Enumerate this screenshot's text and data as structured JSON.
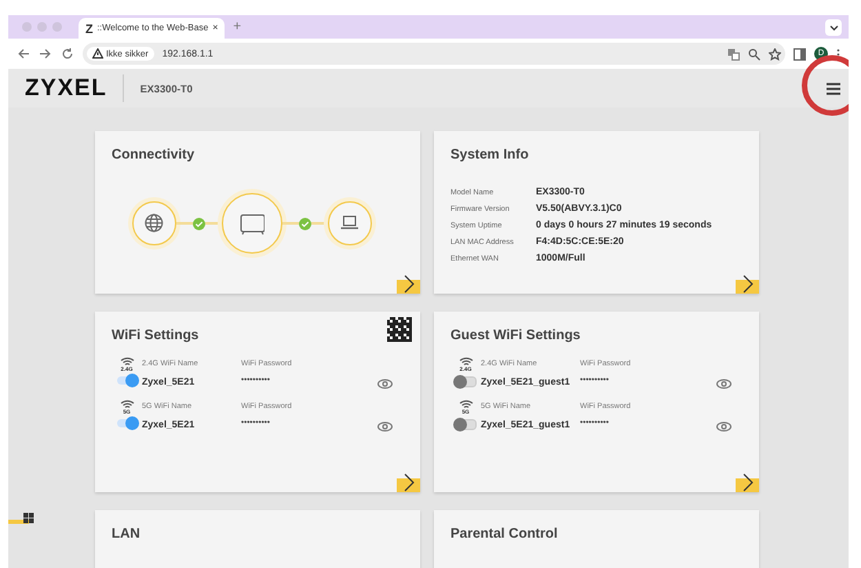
{
  "browser": {
    "tab_icon": "Z",
    "tab_title": "::Welcome to the Web-Base",
    "tab_close": "×",
    "new_tab": "+",
    "security": "Ikke sikker",
    "url": "192.168.1.1",
    "profile": "D"
  },
  "header": {
    "logo": "ZYXEL",
    "model": "EX3300-T0"
  },
  "connectivity": {
    "title": "Connectivity",
    "links": [
      {
        "connected": true
      },
      {
        "connected": true
      }
    ]
  },
  "system_info": {
    "title": "System Info",
    "rows": [
      {
        "label": "Model Name",
        "value": "EX3300-T0"
      },
      {
        "label": "Firmware Version",
        "value": "V5.50(ABVY.3.1)C0"
      },
      {
        "label": "System Uptime",
        "value": "0 days 0 hours 27 minutes 19 seconds"
      },
      {
        "label": "LAN MAC Address",
        "value": "F4:4D:5C:CE:5E:20"
      },
      {
        "label": "Ethernet WAN",
        "value": "1000M/Full"
      }
    ]
  },
  "wifi": {
    "title": "WiFi Settings",
    "networks": [
      {
        "band": "2.4G",
        "name_label": "2.4G WiFi Name",
        "name": "Zyxel_5E21",
        "password_label": "WiFi Password",
        "password": "••••••••••",
        "on": true
      },
      {
        "band": "5G",
        "name_label": "5G WiFi Name",
        "name": "Zyxel_5E21",
        "password_label": "WiFi Password",
        "password": "••••••••••",
        "on": true
      }
    ]
  },
  "guest_wifi": {
    "title": "Guest WiFi Settings",
    "networks": [
      {
        "band": "2.4G",
        "name_label": "2.4G WiFi Name",
        "name": "Zyxel_5E21_guest1",
        "password_label": "WiFi Password",
        "password": "••••••••••",
        "on": false
      },
      {
        "band": "5G",
        "name_label": "5G WiFi Name",
        "name": "Zyxel_5E21_guest1",
        "password_label": "WiFi Password",
        "password": "••••••••••",
        "on": false
      }
    ]
  },
  "lower_cards": [
    {
      "title": "LAN"
    },
    {
      "title": "Parental Control"
    }
  ]
}
